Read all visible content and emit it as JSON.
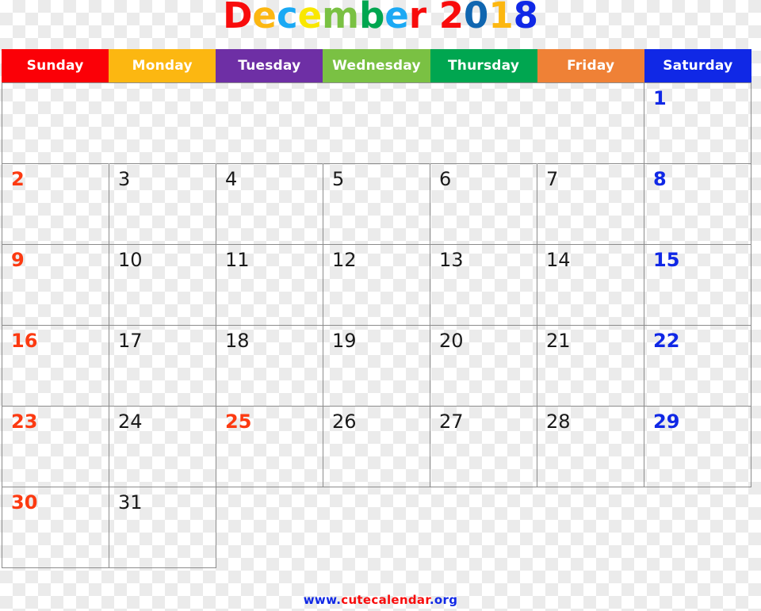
{
  "title": {
    "text": "December 2018",
    "month": "December",
    "year": "2018",
    "letters": [
      {
        "ch": "D",
        "color": "#f80c0c"
      },
      {
        "ch": "e",
        "color": "#fcb711"
      },
      {
        "ch": "c",
        "color": "#1ba9f4"
      },
      {
        "ch": "e",
        "color": "#f9e700"
      },
      {
        "ch": "m",
        "color": "#7ac143"
      },
      {
        "ch": "b",
        "color": "#00a650"
      },
      {
        "ch": "e",
        "color": "#1ba9f4"
      },
      {
        "ch": "r",
        "color": "#f80c0c"
      },
      {
        "ch": " ",
        "color": "#000000"
      },
      {
        "ch": "2",
        "color": "#f80c0c"
      },
      {
        "ch": "0",
        "color": "#1066b0"
      },
      {
        "ch": "1",
        "color": "#fcb711"
      },
      {
        "ch": "8",
        "color": "#1028e6"
      }
    ]
  },
  "weekdays": [
    {
      "label": "Sunday",
      "bg": "#fb0007",
      "fg": "#ffffff"
    },
    {
      "label": "Monday",
      "bg": "#fcb711",
      "fg": "#ffffff"
    },
    {
      "label": "Tuesday",
      "bg": "#6e2fa5",
      "fg": "#ffffff"
    },
    {
      "label": "Wednesday",
      "bg": "#7ac143",
      "fg": "#ffffff"
    },
    {
      "label": "Thursday",
      "bg": "#00a650",
      "fg": "#ffffff"
    },
    {
      "label": "Friday",
      "bg": "#ef8136",
      "fg": "#ffffff"
    },
    {
      "label": "Saturday",
      "bg": "#1028e6",
      "fg": "#ffffff"
    }
  ],
  "grid": {
    "columns": 7,
    "rows": 6,
    "line_color": "#8c8c8c",
    "cells": [
      [
        {
          "day": "",
          "kind": "empty"
        },
        {
          "day": "",
          "kind": "empty"
        },
        {
          "day": "",
          "kind": "empty"
        },
        {
          "day": "",
          "kind": "empty"
        },
        {
          "day": "",
          "kind": "empty"
        },
        {
          "day": "",
          "kind": "empty"
        },
        {
          "day": "1",
          "kind": "sat"
        }
      ],
      [
        {
          "day": "2",
          "kind": "sun"
        },
        {
          "day": "3",
          "kind": "weekday"
        },
        {
          "day": "4",
          "kind": "weekday"
        },
        {
          "day": "5",
          "kind": "weekday"
        },
        {
          "day": "6",
          "kind": "weekday"
        },
        {
          "day": "7",
          "kind": "weekday"
        },
        {
          "day": "8",
          "kind": "sat"
        }
      ],
      [
        {
          "day": "9",
          "kind": "sun"
        },
        {
          "day": "10",
          "kind": "weekday"
        },
        {
          "day": "11",
          "kind": "weekday"
        },
        {
          "day": "12",
          "kind": "weekday"
        },
        {
          "day": "13",
          "kind": "weekday"
        },
        {
          "day": "14",
          "kind": "weekday"
        },
        {
          "day": "15",
          "kind": "sat"
        }
      ],
      [
        {
          "day": "16",
          "kind": "sun"
        },
        {
          "day": "17",
          "kind": "weekday"
        },
        {
          "day": "18",
          "kind": "weekday"
        },
        {
          "day": "19",
          "kind": "weekday"
        },
        {
          "day": "20",
          "kind": "weekday"
        },
        {
          "day": "21",
          "kind": "weekday"
        },
        {
          "day": "22",
          "kind": "sat"
        }
      ],
      [
        {
          "day": "23",
          "kind": "sun"
        },
        {
          "day": "24",
          "kind": "weekday"
        },
        {
          "day": "25",
          "kind": "holiday"
        },
        {
          "day": "26",
          "kind": "weekday"
        },
        {
          "day": "27",
          "kind": "weekday"
        },
        {
          "day": "28",
          "kind": "weekday"
        },
        {
          "day": "29",
          "kind": "sat"
        }
      ],
      [
        {
          "day": "30",
          "kind": "sun"
        },
        {
          "day": "31",
          "kind": "weekday"
        },
        {
          "day": "",
          "kind": "empty"
        },
        {
          "day": "",
          "kind": "empty"
        },
        {
          "day": "",
          "kind": "empty"
        },
        {
          "day": "",
          "kind": "empty"
        },
        {
          "day": "",
          "kind": "empty"
        }
      ]
    ]
  },
  "footer": {
    "text": "www.cutecalendar.org",
    "parts": [
      {
        "t": "www",
        "color": "#1028e6"
      },
      {
        "t": ".",
        "color": "#1028e6"
      },
      {
        "t": "cutecalendar",
        "color": "#f80c0c"
      },
      {
        "t": ".",
        "color": "#1028e6"
      },
      {
        "t": "org",
        "color": "#1028e6"
      }
    ]
  },
  "colors": {
    "sunday_text": "#fc3a11",
    "saturday_text": "#1028e6",
    "weekday_text": "#1a1a1a",
    "holiday_text": "#fc3a11",
    "grid_line": "#8c8c8c"
  }
}
